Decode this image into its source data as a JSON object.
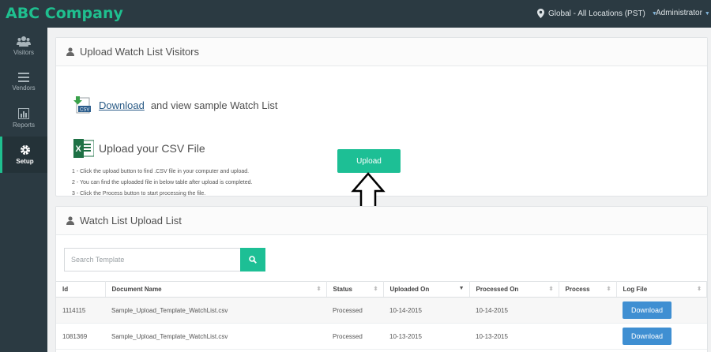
{
  "header": {
    "logo": "ABC Company",
    "location": "Global - All Locations (PST)",
    "user": "Administrator"
  },
  "sidebar": {
    "items": [
      {
        "label": "Visitors",
        "icon": "users-icon"
      },
      {
        "label": "Vendors",
        "icon": "list-icon"
      },
      {
        "label": "Reports",
        "icon": "bar-chart-icon"
      },
      {
        "label": "Setup",
        "icon": "gear-icon",
        "active": true
      }
    ]
  },
  "upload_panel": {
    "title": "Upload Watch List Visitors",
    "download_link": "Download",
    "download_text": "and view sample Watch List",
    "upload_title": "Upload your CSV File",
    "steps": [
      "1 - Click the upload button to find .CSV file in your computer and upload.",
      "2 - You can find the uploaded file in below table after upload is completed.",
      "3 - Click the Process button to start processing the file."
    ],
    "upload_button": "Upload"
  },
  "list_panel": {
    "title": "Watch List Upload List",
    "search_placeholder": "Search Template",
    "columns": [
      "Id",
      "Document Name",
      "Status",
      "Uploaded On",
      "Processed On",
      "Process",
      "Log File"
    ],
    "rows": [
      {
        "id": "1114115",
        "name": "Sample_Upload_Template_WatchList.csv",
        "status": "Processed",
        "uploaded": "10-14-2015",
        "processed": "10-14-2015",
        "process": "",
        "log": "Download"
      },
      {
        "id": "1081369",
        "name": "Sample_Upload_Template_WatchList.csv",
        "status": "Processed",
        "uploaded": "10-13-2015",
        "processed": "10-13-2015",
        "process": "",
        "log": "Download"
      }
    ]
  },
  "colors": {
    "accent": "#1dbf95",
    "topbar": "#2b3a42",
    "button_blue": "#3f8fd2"
  }
}
